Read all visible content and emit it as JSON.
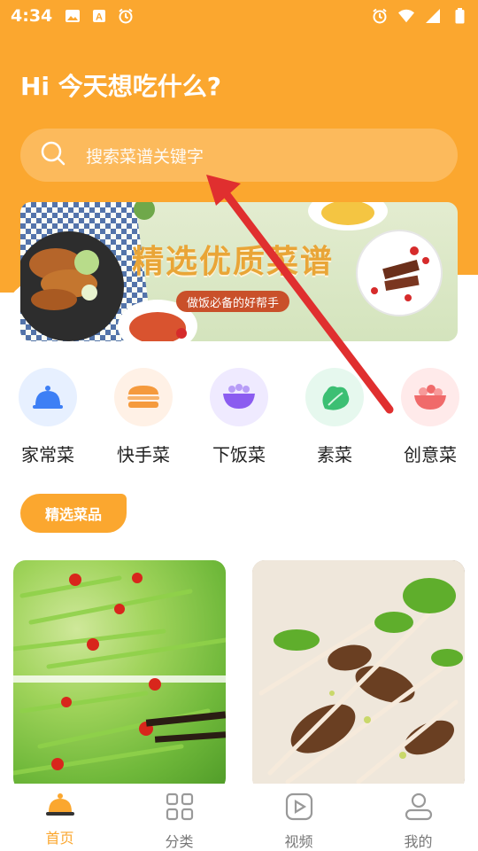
{
  "status_bar": {
    "time": "4:34",
    "left_icons": [
      "image-icon",
      "a-icon",
      "alarm-icon"
    ],
    "right_icons": [
      "alarm-icon",
      "wifi-icon",
      "signal-icon",
      "battery-icon"
    ]
  },
  "header": {
    "greeting": "Hi 今天想吃什么?",
    "search_placeholder": "搜索菜谱关键字"
  },
  "banner": {
    "title": "精选优质菜谱",
    "subtitle": "做饭必备的好帮手"
  },
  "categories": [
    {
      "label": "家常菜",
      "icon": "cloche-icon",
      "bg": "#e7f0ff",
      "accent": "#3d7ff5"
    },
    {
      "label": "快手菜",
      "icon": "burger-icon",
      "bg": "#fff1e6",
      "accent": "#f59a3d"
    },
    {
      "label": "下饭菜",
      "icon": "bowl-icon",
      "bg": "#efeaff",
      "accent": "#8b5cf0"
    },
    {
      "label": "素菜",
      "icon": "vegetable-icon",
      "bg": "#e6f8ee",
      "accent": "#3cbf73"
    },
    {
      "label": "创意菜",
      "icon": "salad-icon",
      "bg": "#ffeaea",
      "accent": "#f06a6a"
    }
  ],
  "section": {
    "title": "精选菜品"
  },
  "recipes": [
    {
      "name": "recipe-card-1"
    },
    {
      "name": "recipe-card-2"
    }
  ],
  "tabbar": {
    "tabs": [
      {
        "label": "首页",
        "icon": "home-cloche-icon",
        "active": true
      },
      {
        "label": "分类",
        "icon": "grid-icon",
        "active": false
      },
      {
        "label": "视频",
        "icon": "video-icon",
        "active": false
      },
      {
        "label": "我的",
        "icon": "user-icon",
        "active": false
      }
    ]
  },
  "colors": {
    "brand": "#fba72f",
    "annotation_arrow": "#e02f2f"
  }
}
